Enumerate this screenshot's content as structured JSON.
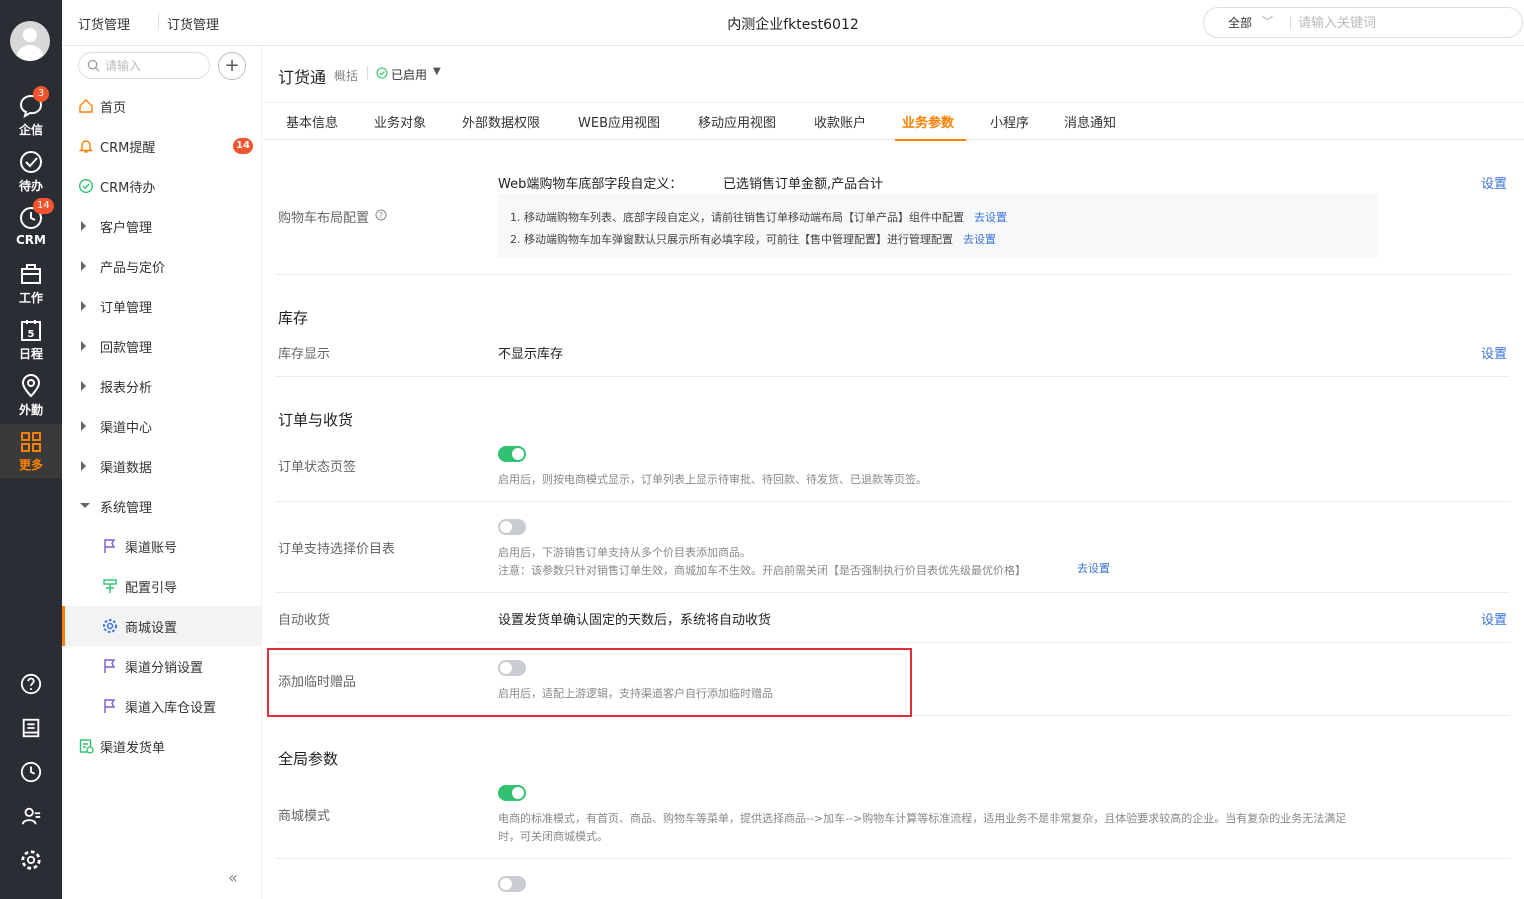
{
  "rail": {
    "items": [
      {
        "label": "企信",
        "icon": "chat-icon",
        "badge": "3"
      },
      {
        "label": "待办",
        "icon": "check-circle-icon",
        "badge": ""
      },
      {
        "label": "CRM",
        "icon": "clock-icon",
        "badge": "14"
      },
      {
        "label": "工作",
        "icon": "briefcase-icon",
        "badge": ""
      },
      {
        "label": "日程",
        "icon": "calendar-icon",
        "badge": ""
      },
      {
        "label": "外勤",
        "icon": "location-icon",
        "badge": ""
      },
      {
        "label": "更多",
        "icon": "grid-icon",
        "badge": "",
        "active": true
      }
    ],
    "calendar_day": "5",
    "bottom_icons": [
      "help-icon",
      "notebook-icon",
      "history-icon",
      "contacts-icon",
      "settings-icon"
    ]
  },
  "topbar": {
    "crumb1": "订货管理",
    "crumb2": "订货管理",
    "company": "内测企业fktest6012",
    "search_scope": "全部",
    "search_placeholder": "请输入关键词"
  },
  "side": {
    "search_placeholder": "请输入",
    "items": [
      {
        "label": "首页",
        "icon": "home-icon"
      },
      {
        "label": "CRM提醒",
        "icon": "bell-icon",
        "badge": "14"
      },
      {
        "label": "CRM待办",
        "icon": "check-circle-icon"
      },
      {
        "label": "客户管理"
      },
      {
        "label": "产品与定价"
      },
      {
        "label": "订单管理"
      },
      {
        "label": "回款管理"
      },
      {
        "label": "报表分析"
      },
      {
        "label": "渠道中心"
      },
      {
        "label": "渠道数据"
      },
      {
        "label": "系统管理"
      },
      {
        "label": "渠道账号",
        "icon": "flag-icon"
      },
      {
        "label": "配置引导",
        "icon": "guide-icon"
      },
      {
        "label": "商城设置",
        "icon": "gear-icon",
        "active": true
      },
      {
        "label": "渠道分销设置",
        "icon": "flag-icon"
      },
      {
        "label": "渠道入库仓设置",
        "icon": "flag-icon"
      },
      {
        "label": "渠道发货单",
        "icon": "delivery-icon"
      }
    ]
  },
  "main": {
    "app_title": "订货通",
    "app_sub": "概括",
    "status": "已启用",
    "tabs": [
      "基本信息",
      "业务对象",
      "外部数据权限",
      "WEB应用视图",
      "移动应用视图",
      "收款账户",
      "业务参数",
      "小程序",
      "消息通知"
    ],
    "active_tab": "业务参数",
    "cart": {
      "label": "购物车布局配置",
      "field_title": "Web端购物车底部字段自定义：",
      "field_value": "已选销售订单金额,产品合计",
      "set": "设置",
      "note1": "1. 移动端购物车列表、底部字段自定义，请前往销售订单移动端布局【订单产品】组件中配置",
      "note1_link": "去设置",
      "note2": "2. 移动端购物车加车弹窗默认只展示所有必填字段，可前往【售中管理配置】进行管理配置",
      "note2_link": "去设置"
    },
    "stock": {
      "section": "库存",
      "label": "库存显示",
      "value": "不显示库存",
      "set": "设置"
    },
    "order": {
      "section": "订单与收货",
      "status_tab_label": "订单状态页签",
      "status_tab_on": true,
      "status_tab_hint": "启用后，则按电商模式显示，订单列表上显示待审批、待回款、待发货、已退款等页签。",
      "pricebook_label": "订单支持选择价目表",
      "pricebook_on": false,
      "pricebook_hint1": "启用后，下游销售订单支持从多个价目表添加商品。",
      "pricebook_hint2": "注意：该参数只针对销售订单生效，商城加车不生效。开启前需关闭【是否强制执行价目表优先级最优价格】",
      "pricebook_link": "去设置",
      "auto_receive_label": "自动收货",
      "auto_receive_value": "设置发货单确认固定的天数后，系统将自动收货",
      "auto_receive_set": "设置",
      "gift_label": "添加临时赠品",
      "gift_on": false,
      "gift_hint": "启用后，适配上游逻辑，支持渠道客户自行添加临时赠品"
    },
    "global": {
      "section": "全局参数",
      "mall_label": "商城模式",
      "mall_on": true,
      "mall_hint1": "电商的标准模式，有首页、商品、购物车等菜单，提供选择商品-->加车-->购物车计算等标准流程，适用业务不是非常复杂，且体验要求较高的企业。当有复杂的业务无法满足",
      "mall_hint2": "时，可关闭商城模式。",
      "last_on": false
    }
  },
  "colors": {
    "accent": "#ff8000",
    "link": "#3b73d8",
    "toggle_on": "#30c271",
    "highlight_box": "#e0303a"
  }
}
